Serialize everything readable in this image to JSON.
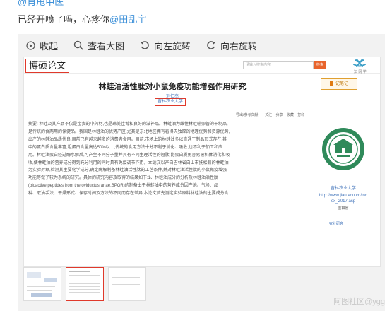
{
  "mention_top": "@肖甩中医",
  "post": {
    "text": "已经开喷了吗，心疼你",
    "mention": "@田乱宇"
  },
  "toolbar": {
    "collapse": "收起",
    "view_large": "查看大图",
    "rotate_left": "向左旋转",
    "rotate_right": "向右旋转"
  },
  "screenshot": {
    "label": "博硕论文",
    "search_placeholder": "请输入搜索内容",
    "search_button": "检索",
    "logo_caption": "知 网 学",
    "title": "林蛙油活性肽对小鼠免疫功能增强作用研究",
    "note_button": "记笔记",
    "author": "刘仁杰",
    "org": "吉林农业大学",
    "actions": [
      "导出/参考文献",
      "+ 关注",
      "分享",
      "收藏",
      "打印"
    ],
    "abstract": "摘要: 林蛙及其产品不仅是宝贵的中药材,也是珠美佳肴和良好的滋补品。林蛙油为雌性林蛙输卵管的干制品,\n是传统的食两用的保健品。我国是林蛙油的优势产区,尤其是东北地区拥有着得天独厚的地理优势和资源优势,\n出产的林蛙油品质优良,目前已有越来越多的消费者食用。目前,市场上的林蛙油多以直通干制品形式存在,其\n中的蛋白质含量丰富,粗蛋白含量高达50%以上,传统的食用方法十分不利于消化、吸收,也不利于加工和应\n用。林蛙油蛋白经过酶水解后,可产生不同分子量并具有不同生理活性的短肽,比蛋白质更容易被机体消化和吸\n收,使林蛙油的营养成分得到充分利用的同时具有免疫调节作用。本论文以产自吉林省白山市抚松县的林蛙油\n为实验对象,检测其主要化学成分,确定酶解制备林蛙油活性肽的工艺条件,并对林蛙油活性肽的小鼠免疫增强\n功能等做了较为系统的研究。具体的研究内容及取得的结果如下:1、林蛙油成分的分析及林蛙油活性肽\n(bioactive peptides from the oviductusranae,BPOR)的制备由于林蛙油中的营养成分因产地、气候、品\n种、取油手法、干燥形式、保存时间及方法的不同而存在差异,本论文首先测定实验原料林蛙油的主要成分含",
    "side": {
      "org": "吉林农业大学",
      "url": "http://www.jlau.edu.cn/index_2017.asp",
      "small": "吉林省",
      "more": "农业研究"
    }
  },
  "watermark": "阿图社区@ygg"
}
